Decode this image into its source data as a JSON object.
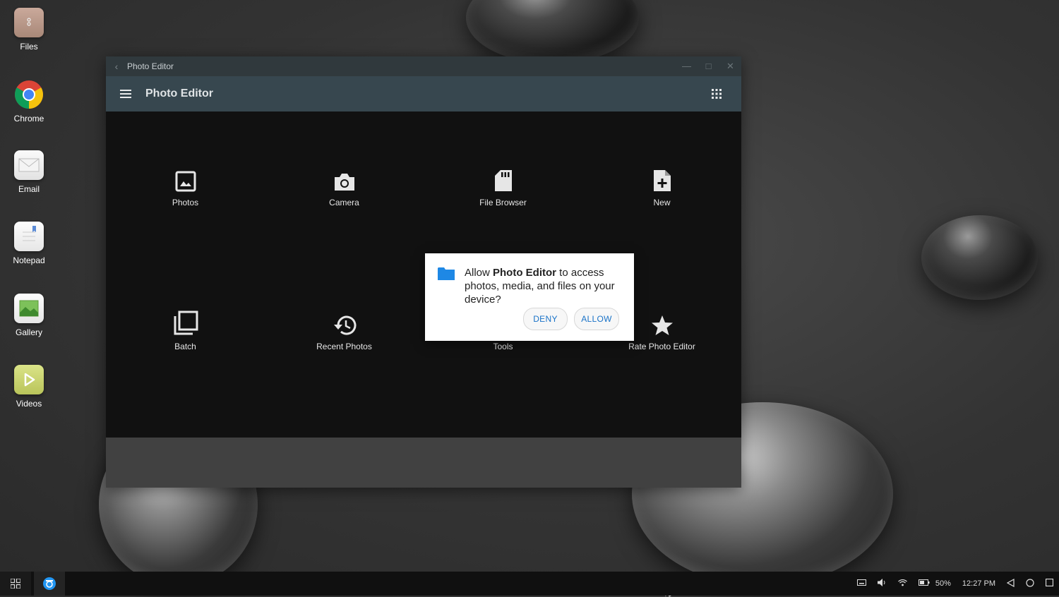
{
  "desktop": {
    "icons": [
      {
        "label": "Files"
      },
      {
        "label": "Chrome"
      },
      {
        "label": "Email"
      },
      {
        "label": "Notepad"
      },
      {
        "label": "Gallery"
      },
      {
        "label": "Videos"
      }
    ]
  },
  "window": {
    "titlebar_title": "Photo Editor",
    "appbar_title": "Photo Editor",
    "tools": [
      {
        "label": "Photos"
      },
      {
        "label": "Camera"
      },
      {
        "label": "File Browser"
      },
      {
        "label": "New"
      },
      {
        "label": "Batch"
      },
      {
        "label": "Recent Photos"
      },
      {
        "label": "Tools"
      },
      {
        "label": "Rate Photo Editor"
      }
    ]
  },
  "dialog": {
    "prefix": "Allow ",
    "app_name": "Photo Editor",
    "suffix": " to access photos, media, and files on your device?",
    "deny_label": "DENY",
    "allow_label": "ALLOW"
  },
  "taskbar": {
    "battery": "50%",
    "time": "12:27 PM"
  },
  "colors": {
    "appbar": "#37474f",
    "titlebar": "#30393d",
    "accent": "#1a73c8",
    "folder": "#1e88e5"
  }
}
